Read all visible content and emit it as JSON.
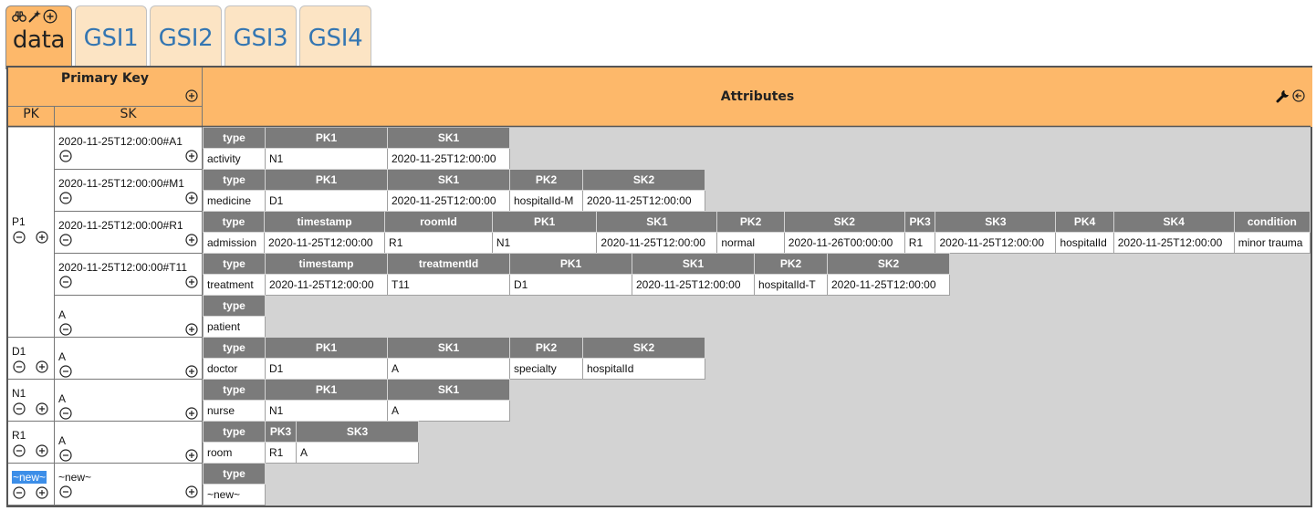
{
  "tabs": [
    {
      "label": "data",
      "active": true
    },
    {
      "label": "GSI1"
    },
    {
      "label": "GSI2"
    },
    {
      "label": "GSI3"
    },
    {
      "label": "GSI4"
    }
  ],
  "header": {
    "primary_key": "Primary Key",
    "pk": "PK",
    "sk": "SK",
    "attributes": "Attributes"
  },
  "colors": {
    "header": "#fdb86a",
    "attr_header": "#7b7b7b",
    "canvas": "#d3d3d3",
    "tab_text": "#3476b2",
    "selection": "#3c8ee8"
  },
  "icons": {
    "plus": "plus-circle-icon",
    "minus": "minus-circle-icon",
    "wrench": "wrench-icon",
    "back": "arrow-left-circle-icon"
  },
  "partitions": [
    {
      "pk": "P1",
      "items": [
        {
          "sk": "2020-11-25T12:00:00#A1",
          "headers": [
            "type",
            "PK1",
            "SK1"
          ],
          "values": [
            "activity",
            "N1",
            "2020-11-25T12:00:00"
          ]
        },
        {
          "sk": "2020-11-25T12:00:00#M1",
          "headers": [
            "type",
            "PK1",
            "SK1",
            "PK2",
            "SK2"
          ],
          "values": [
            "medicine",
            "D1",
            "2020-11-25T12:00:00",
            "hospitalId-M",
            "2020-11-25T12:00:00"
          ]
        },
        {
          "sk": "2020-11-25T12:00:00#R1",
          "headers": [
            "type",
            "timestamp",
            "roomId",
            "PK1",
            "SK1",
            "PK2",
            "SK2",
            "PK3",
            "SK3",
            "PK4",
            "SK4",
            "condition"
          ],
          "values": [
            "admission",
            "2020-11-25T12:00:00",
            "R1",
            "N1",
            "2020-11-25T12:00:00",
            "normal",
            "2020-11-26T00:00:00",
            "R1",
            "2020-11-25T12:00:00",
            "hospitalId",
            "2020-11-25T12:00:00",
            "minor trauma"
          ]
        },
        {
          "sk": "2020-11-25T12:00:00#T11",
          "headers": [
            "type",
            "timestamp",
            "treatmentId",
            "PK1",
            "SK1",
            "PK2",
            "SK2"
          ],
          "values": [
            "treatment",
            "2020-11-25T12:00:00",
            "T11",
            "D1",
            "2020-11-25T12:00:00",
            "hospitalId-T",
            "2020-11-25T12:00:00"
          ]
        },
        {
          "sk": "A",
          "headers": [
            "type"
          ],
          "values": [
            "patient"
          ]
        }
      ]
    },
    {
      "pk": "D1",
      "items": [
        {
          "sk": "A",
          "headers": [
            "type",
            "PK1",
            "SK1",
            "PK2",
            "SK2"
          ],
          "values": [
            "doctor",
            "D1",
            "A",
            "specialty",
            "hospitalId"
          ]
        }
      ]
    },
    {
      "pk": "N1",
      "items": [
        {
          "sk": "A",
          "headers": [
            "type",
            "PK1",
            "SK1"
          ],
          "values": [
            "nurse",
            "N1",
            "A"
          ]
        }
      ]
    },
    {
      "pk": "R1",
      "items": [
        {
          "sk": "A",
          "headers": [
            "type",
            "PK3",
            "SK3"
          ],
          "values": [
            "room",
            "R1",
            "A"
          ]
        }
      ]
    },
    {
      "pk": "~new~",
      "selected": true,
      "items": [
        {
          "sk": "~new~",
          "headers": [
            "type"
          ],
          "values": [
            "~new~"
          ]
        }
      ]
    }
  ]
}
